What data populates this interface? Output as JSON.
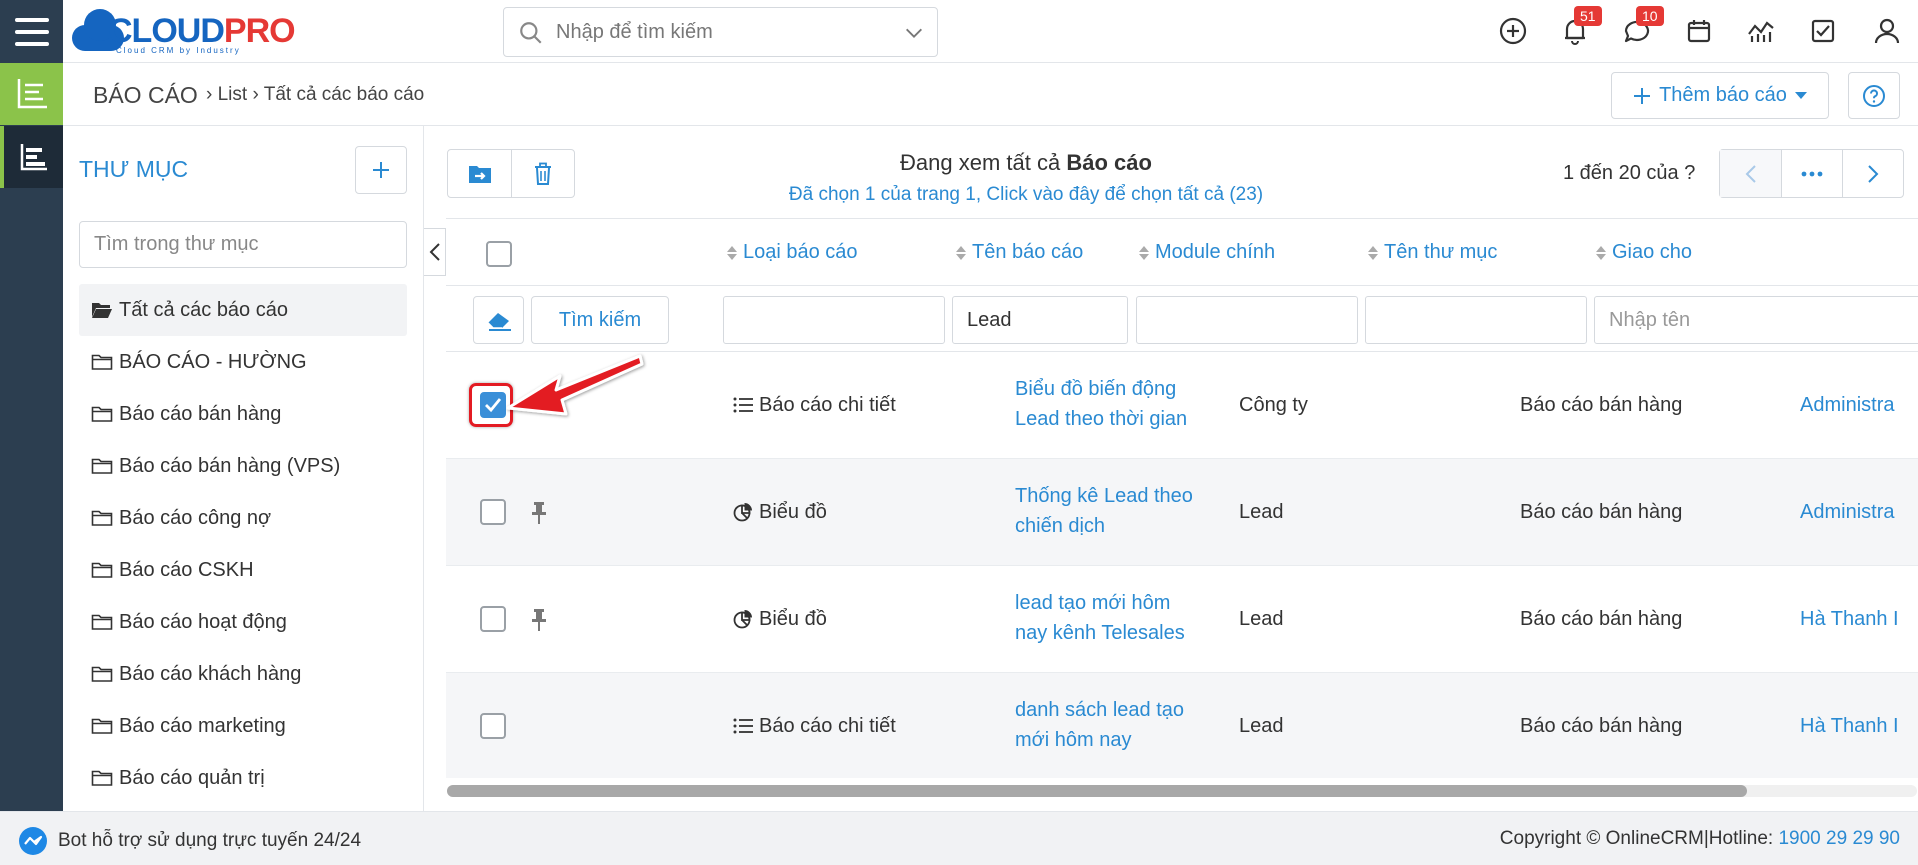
{
  "header": {
    "logo_text_a": "CLOUD",
    "logo_text_b": "PRO",
    "logo_sub": "Cloud CRM by Industry",
    "search_placeholder": "Nhập để tìm kiếm",
    "notifications_count": "51",
    "messages_count": "10"
  },
  "breadcrumb": {
    "title": "BÁO CÁO",
    "path": "› List › Tất cả các báo cáo",
    "add_label": "Thêm báo cáo"
  },
  "folders": {
    "heading": "THƯ MỤC",
    "search_placeholder": "Tìm trong thư mục",
    "items": [
      "Tất cả các báo cáo",
      "BÁO CÁO - HƯỜNG",
      "Báo cáo bán hàng",
      "Báo cáo bán hàng (VPS)",
      "Báo cáo công nợ",
      "Báo cáo CSKH",
      "Báo cáo hoạt động",
      "Báo cáo khách hàng",
      "Báo cáo marketing",
      "Báo cáo quản trị"
    ]
  },
  "listing": {
    "viewing_prefix": "Đang xem tất cả ",
    "viewing_bold": "Báo cáo",
    "selected_text": "Đã chọn 1 của trang 1, Click vào đây để chọn tất cả (23)",
    "pager_text": "1 đến 20 của",
    "pager_unknown": "?"
  },
  "table": {
    "headers": [
      "Loại báo cáo",
      "Tên báo cáo",
      "Module chính",
      "Tên thư mục",
      "Giao cho"
    ],
    "search_button": "Tìm kiếm",
    "filter_values": [
      "",
      "Lead",
      "",
      "",
      ""
    ],
    "filter_assign_placeholder": "Nhập tên",
    "rows": [
      {
        "checked": true,
        "pinned": false,
        "type": "Báo cáo chi tiết",
        "type_icon": "list-icon",
        "name_l1": "Biểu đồ biến động",
        "name_l2": "Lead theo thời gian",
        "module": "Công ty",
        "folder": "Báo cáo bán hàng",
        "assignee": "Administra"
      },
      {
        "checked": false,
        "pinned": true,
        "type": "Biểu đồ",
        "type_icon": "pie-chart-icon",
        "name_l1": "Thống kê Lead theo",
        "name_l2": "chiến dịch",
        "module": "Lead",
        "folder": "Báo cáo bán hàng",
        "assignee": "Administra"
      },
      {
        "checked": false,
        "pinned": true,
        "type": "Biểu đồ",
        "type_icon": "pie-chart-icon",
        "name_l1": "lead tạo mới hôm",
        "name_l2": "nay kênh Telesales",
        "module": "Lead",
        "folder": "Báo cáo bán hàng",
        "assignee": "Hà Thanh I"
      },
      {
        "checked": false,
        "pinned": false,
        "type": "Báo cáo chi tiết",
        "type_icon": "list-icon",
        "name_l1": "danh sách lead tạo",
        "name_l2": "mới hôm nay",
        "module": "Lead",
        "folder": "Báo cáo bán hàng",
        "assignee": "Hà Thanh I"
      }
    ]
  },
  "footer": {
    "bot_text": "Bot hỗ trợ sử dụng trực tuyến 24/24",
    "copyright": "Copyright © OnlineCRM|Hotline: ",
    "hotline": "1900 29 29 90"
  },
  "colors": {
    "sidebar": "#2c3e50",
    "accent_green": "#8bc34a",
    "link_blue": "#2a8ad2",
    "highlight_red": "#e31b23",
    "badge_red": "#e53935"
  }
}
